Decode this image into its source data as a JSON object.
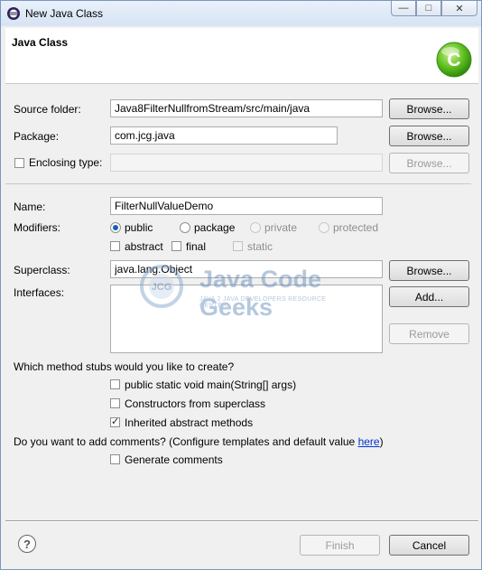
{
  "window": {
    "title": "New Java Class",
    "controls": {
      "minimize": "—",
      "maximize": "□",
      "close": "✕"
    }
  },
  "header": {
    "title": "Java Class",
    "logo_letter": "C"
  },
  "source_folder": {
    "label": "Source folder:",
    "value": "Java8FilterNullfromStream/src/main/java",
    "browse": "Browse..."
  },
  "package": {
    "label": "Package:",
    "value": "com.jcg.java",
    "browse": "Browse..."
  },
  "enclosing_type": {
    "label": "Enclosing type:",
    "value": "",
    "browse": "Browse...",
    "checked": false
  },
  "name": {
    "label": "Name:",
    "value": "FilterNullValueDemo"
  },
  "modifiers": {
    "label": "Modifiers:",
    "access": [
      {
        "label": "public",
        "selected": true,
        "enabled": true
      },
      {
        "label": "package",
        "selected": false,
        "enabled": true
      },
      {
        "label": "private",
        "selected": false,
        "enabled": false
      },
      {
        "label": "protected",
        "selected": false,
        "enabled": false
      }
    ],
    "flags": [
      {
        "label": "abstract",
        "checked": false,
        "enabled": true
      },
      {
        "label": "final",
        "checked": false,
        "enabled": true
      },
      {
        "label": "static",
        "checked": false,
        "enabled": false
      }
    ]
  },
  "superclass": {
    "label": "Superclass:",
    "value": "java.lang.Object",
    "browse": "Browse..."
  },
  "interfaces": {
    "label": "Interfaces:",
    "add": "Add...",
    "remove": "Remove"
  },
  "watermark": {
    "name": "Java Code Geeks",
    "tagline": "JAVA 2 JAVA DEVELOPERS RESOURCE CENTER",
    "badge": "JCG"
  },
  "stubs": {
    "question": "Which method stubs would you like to create?",
    "options": [
      {
        "label": "public static void main(String[] args)",
        "checked": false
      },
      {
        "label": "Constructors from superclass",
        "checked": false
      },
      {
        "label": "Inherited abstract methods",
        "checked": true
      }
    ]
  },
  "comments": {
    "question": "Do you want to add comments? (Configure templates and default value ",
    "link": "here",
    "question_end": ")",
    "generate": {
      "label": "Generate comments",
      "checked": false
    }
  },
  "footer": {
    "help": "?",
    "finish": "Finish",
    "cancel": "Cancel"
  }
}
